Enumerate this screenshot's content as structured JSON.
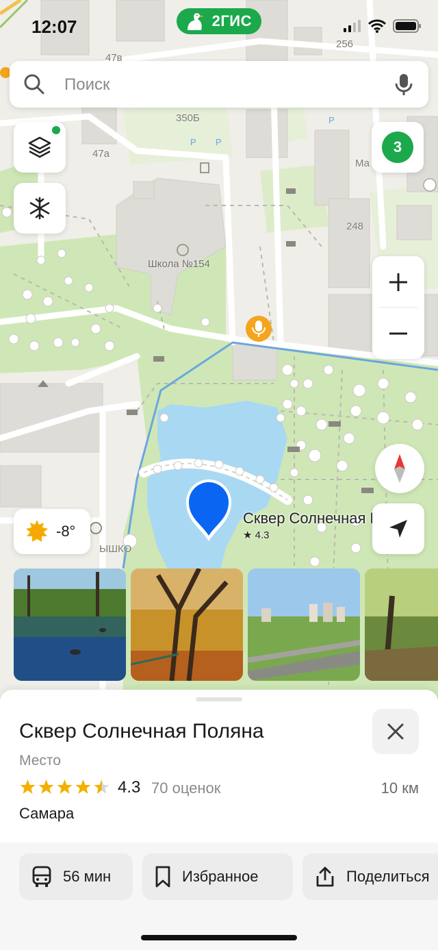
{
  "status_bar": {
    "time": "12:07",
    "brand": "2ГИС"
  },
  "search": {
    "placeholder": "Поиск"
  },
  "map": {
    "traffic_score": "3",
    "weather_temp": "-8°",
    "poi_name": "Сквер Солнечная Поляна",
    "poi_rating": "★ 4.3",
    "labels": {
      "school": "Школа №154",
      "house_350b": "350Б",
      "house_47v": "47в",
      "house_47a": "47а",
      "house_256": "256",
      "house_248": "248",
      "cut_label_ma": "Ма",
      "cut_label_yshko": "ЫШКО"
    }
  },
  "photos": [
    {
      "alt": "pond-photo"
    },
    {
      "alt": "autumn-trees-photo"
    },
    {
      "alt": "city-view-photo"
    },
    {
      "alt": "park-photo"
    }
  ],
  "place_card": {
    "title": "Сквер Солнечная Поляна",
    "category": "Место",
    "rating": "4.3",
    "rating_value": 4.3,
    "reviews": "70 оценок",
    "distance": "10 км",
    "city": "Самара"
  },
  "actions": {
    "transit": "56 мин",
    "favorite": "Избранное",
    "share": "Поделиться"
  },
  "colors": {
    "brand_green": "#1ba94c",
    "accent_blue": "#0a66f2",
    "star_yellow": "#f3b000",
    "water": "#a9d8f2",
    "park": "#cfe7b6"
  }
}
